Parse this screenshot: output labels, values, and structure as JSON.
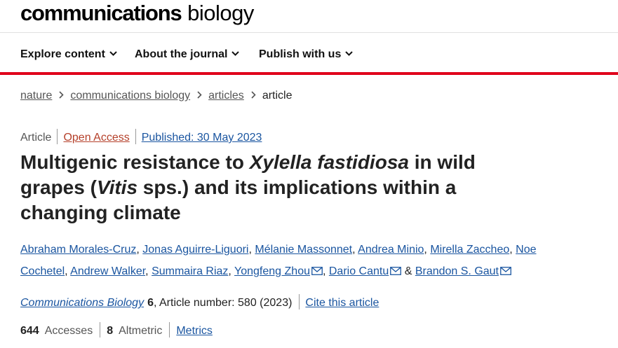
{
  "logo": {
    "strong": "communications",
    "light": "biology"
  },
  "nav": [
    {
      "label": "Explore content"
    },
    {
      "label": "About the journal"
    },
    {
      "label": "Publish with us"
    }
  ],
  "breadcrumb": {
    "items": [
      "nature",
      "communications biology",
      "articles"
    ],
    "current": "article"
  },
  "meta": {
    "type": "Article",
    "access": "Open Access",
    "published": "Published: 30 May 2023"
  },
  "title": {
    "p1": "Multigenic resistance to ",
    "p2": "Xylella fastidiosa",
    "p3": " in wild grapes (",
    "p4": "Vitis",
    "p5": " sps.) and its implications within a changing climate"
  },
  "authors": [
    "Abraham Morales-Cruz",
    "Jonas Aguirre-Liguori",
    "Mélanie Massonnet",
    "Andrea Minio",
    "Mirella Zaccheo",
    "Noe Cochetel",
    "Andrew Walker",
    "Summaira Riaz",
    "Yongfeng Zhou",
    "Dario Cantu",
    "Brandon S. Gaut"
  ],
  "authors_sep": {
    "comma": ", ",
    "amp": " & "
  },
  "citation": {
    "journal": "Communications Biology",
    "volume": "6",
    "rest": ", Article number: 580 (2023)",
    "cite_link": "Cite this article"
  },
  "metrics": {
    "accesses_value": "644",
    "accesses_label": "Accesses",
    "altmetric_value": "8",
    "altmetric_label": "Altmetric",
    "metrics_link": "Metrics"
  }
}
